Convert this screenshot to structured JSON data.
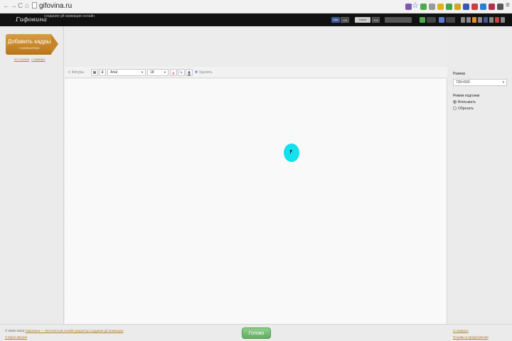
{
  "browser": {
    "url": "gifovina.ru",
    "nav_back": "←",
    "nav_forward": "→",
    "nav_reload": "C",
    "nav_home": "⌂"
  },
  "header": {
    "logo": "Гифовина",
    "tagline": "создание gif-анимации онлайн",
    "btn1": "Like",
    "btn1_count": "125",
    "btn2": "Tweet",
    "btn2_count": "102"
  },
  "left": {
    "add_frames_title": "Добавить кадры",
    "add_frames_sub": "с компьютера",
    "link_url": "по ссылке",
    "link_cam": "с камеры"
  },
  "toolbar": {
    "figures": "Фигуры",
    "bold": "Ж",
    "italic": "К",
    "font_value": "Arial",
    "size_value": "18",
    "delete": "Удалить"
  },
  "right": {
    "size_label": "Размер",
    "size_value": "720×500",
    "fit_label": "Режим подгонки",
    "fit_option1": "Вписывать",
    "fit_option2": "Обрезать"
  },
  "footer": {
    "copyright": "© 2010–2013",
    "site_link": "Гифовина — бесплатный онлайн редактор создания gif анимации",
    "old_version": "Старая версия",
    "done": "Готово",
    "about": "О сервисе",
    "feedback": "Отзывы и предложения"
  },
  "colors": {
    "accent_orange": "#c6852a",
    "done_green": "#6cb569",
    "cursor_highlight": "#13e1ee"
  }
}
